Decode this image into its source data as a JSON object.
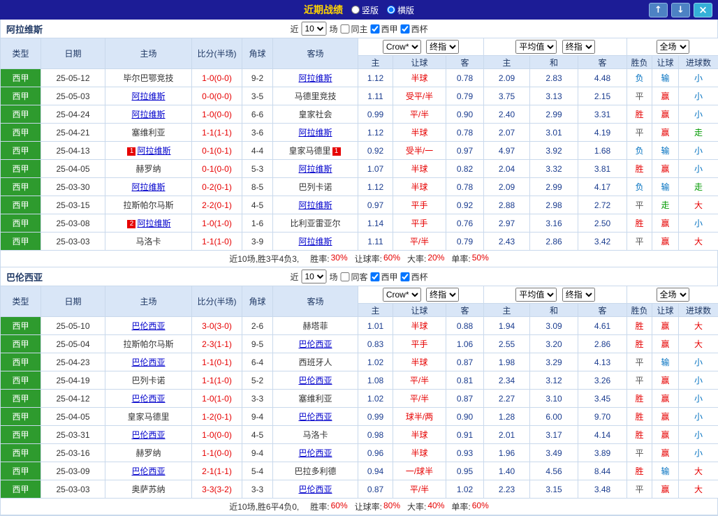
{
  "topbar": {
    "title": "近期战绩",
    "radios": [
      {
        "label": "竖版",
        "checked": false
      },
      {
        "label": "横版",
        "checked": true
      }
    ],
    "up_button": "↑",
    "down_button": "↓",
    "close_button": "×"
  },
  "labels": {
    "recent": "近",
    "matches": "场"
  },
  "filters": {
    "source": "Crow*",
    "source_stage": "终指",
    "average": "平均值",
    "average_stage": "终指",
    "scope": "全场"
  },
  "table_headers": {
    "type": "类型",
    "date": "日期",
    "home": "主场",
    "score": "比分(半场)",
    "corner": "角球",
    "away": "客场",
    "sub": [
      "主",
      "让球",
      "客",
      "主",
      "和",
      "客",
      "胜负",
      "让球",
      "进球数"
    ]
  },
  "colors": {
    "topbar_bg": "#1c1c96",
    "title_gold": "#ffd400",
    "league_green": "#2e9b2e",
    "header_blue": "#d9e6f7",
    "header_text": "#1f3864",
    "positive_red": "#e60000",
    "negative_blue": "#0070c0",
    "push_green": "#009900",
    "team_link_blue": "#0000cc",
    "odds_navy": "#1a3c8f",
    "button_blue": "#4d82c4",
    "close_teal": "#35b0d8",
    "border": "#c9d9ec"
  },
  "sections": [
    {
      "team": "阿拉维斯",
      "count": "10",
      "checkboxes": [
        {
          "label": "同主",
          "checked": false
        },
        {
          "label": "西甲",
          "checked": true
        },
        {
          "label": "西杯",
          "checked": true
        }
      ],
      "rows": [
        {
          "league": "西甲",
          "date": "25-05-12",
          "home": "毕尔巴鄂竞技",
          "home_badge": "",
          "score": "1-0(0-0)",
          "corner": "9-2",
          "away": "阿拉维斯",
          "away_badge": "",
          "ah_home": "1.12",
          "ah_line": "半球",
          "ah_away": "0.78",
          "eu_home": "2.09",
          "eu_draw": "2.83",
          "eu_away": "4.48",
          "result": "负",
          "ah_result": "输",
          "ou_result": "小"
        },
        {
          "league": "西甲",
          "date": "25-05-03",
          "home": "阿拉维斯",
          "home_badge": "",
          "score": "0-0(0-0)",
          "corner": "3-5",
          "away": "马德里竞技",
          "away_badge": "",
          "ah_home": "1.11",
          "ah_line": "受平/半",
          "ah_away": "0.79",
          "eu_home": "3.75",
          "eu_draw": "3.13",
          "eu_away": "2.15",
          "result": "平",
          "ah_result": "赢",
          "ou_result": "小"
        },
        {
          "league": "西甲",
          "date": "25-04-24",
          "home": "阿拉维斯",
          "home_badge": "",
          "score": "1-0(0-0)",
          "corner": "6-6",
          "away": "皇家社会",
          "away_badge": "",
          "ah_home": "0.99",
          "ah_line": "平/半",
          "ah_away": "0.90",
          "eu_home": "2.40",
          "eu_draw": "2.99",
          "eu_away": "3.31",
          "result": "胜",
          "ah_result": "赢",
          "ou_result": "小"
        },
        {
          "league": "西甲",
          "date": "25-04-21",
          "home": "塞维利亚",
          "home_badge": "",
          "score": "1-1(1-1)",
          "corner": "3-6",
          "away": "阿拉维斯",
          "away_badge": "",
          "ah_home": "1.12",
          "ah_line": "半球",
          "ah_away": "0.78",
          "eu_home": "2.07",
          "eu_draw": "3.01",
          "eu_away": "4.19",
          "result": "平",
          "ah_result": "赢",
          "ou_result": "走"
        },
        {
          "league": "西甲",
          "date": "25-04-13",
          "home": "阿拉维斯",
          "home_badge": "1",
          "score": "0-1(0-1)",
          "corner": "4-4",
          "away": "皇家马德里",
          "away_badge": "1",
          "ah_home": "0.92",
          "ah_line": "受半/一",
          "ah_away": "0.97",
          "eu_home": "4.97",
          "eu_draw": "3.92",
          "eu_away": "1.68",
          "result": "负",
          "ah_result": "输",
          "ou_result": "小"
        },
        {
          "league": "西甲",
          "date": "25-04-05",
          "home": "赫罗纳",
          "home_badge": "",
          "score": "0-1(0-0)",
          "corner": "5-3",
          "away": "阿拉维斯",
          "away_badge": "",
          "ah_home": "1.07",
          "ah_line": "半球",
          "ah_away": "0.82",
          "eu_home": "2.04",
          "eu_draw": "3.32",
          "eu_away": "3.81",
          "result": "胜",
          "ah_result": "赢",
          "ou_result": "小"
        },
        {
          "league": "西甲",
          "date": "25-03-30",
          "home": "阿拉维斯",
          "home_badge": "",
          "score": "0-2(0-1)",
          "corner": "8-5",
          "away": "巴列卡诺",
          "away_badge": "",
          "ah_home": "1.12",
          "ah_line": "半球",
          "ah_away": "0.78",
          "eu_home": "2.09",
          "eu_draw": "2.99",
          "eu_away": "4.17",
          "result": "负",
          "ah_result": "输",
          "ou_result": "走"
        },
        {
          "league": "西甲",
          "date": "25-03-15",
          "home": "拉斯帕尔马斯",
          "home_badge": "",
          "score": "2-2(0-1)",
          "corner": "4-5",
          "away": "阿拉维斯",
          "away_badge": "",
          "ah_home": "0.97",
          "ah_line": "平手",
          "ah_away": "0.92",
          "eu_home": "2.88",
          "eu_draw": "2.98",
          "eu_away": "2.72",
          "result": "平",
          "ah_result": "走",
          "ou_result": "大"
        },
        {
          "league": "西甲",
          "date": "25-03-08",
          "home": "阿拉维斯",
          "home_badge": "2",
          "score": "1-0(1-0)",
          "corner": "1-6",
          "away": "比利亚雷亚尔",
          "away_badge": "",
          "ah_home": "1.14",
          "ah_line": "平手",
          "ah_away": "0.76",
          "eu_home": "2.97",
          "eu_draw": "3.16",
          "eu_away": "2.50",
          "result": "胜",
          "ah_result": "赢",
          "ou_result": "小"
        },
        {
          "league": "西甲",
          "date": "25-03-03",
          "home": "马洛卡",
          "home_badge": "",
          "score": "1-1(1-0)",
          "corner": "3-9",
          "away": "阿拉维斯",
          "away_badge": "",
          "ah_home": "1.11",
          "ah_line": "平/半",
          "ah_away": "0.79",
          "eu_home": "2.43",
          "eu_draw": "2.86",
          "eu_away": "3.42",
          "result": "平",
          "ah_result": "赢",
          "ou_result": "大"
        }
      ],
      "summary": {
        "record": "近10场,胜3平4负3,",
        "stats": [
          {
            "label": "胜率:",
            "value": "30%"
          },
          {
            "label": "让球率:",
            "value": "60%"
          },
          {
            "label": "大率:",
            "value": "20%"
          },
          {
            "label": "单率:",
            "value": "50%"
          }
        ]
      }
    },
    {
      "team": "巴伦西亚",
      "count": "10",
      "checkboxes": [
        {
          "label": "同客",
          "checked": false
        },
        {
          "label": "西甲",
          "checked": true
        },
        {
          "label": "西杯",
          "checked": true
        }
      ],
      "rows": [
        {
          "league": "西甲",
          "date": "25-05-10",
          "home": "巴伦西亚",
          "home_badge": "",
          "score": "3-0(3-0)",
          "corner": "2-6",
          "away": "赫塔菲",
          "away_badge": "",
          "ah_home": "1.01",
          "ah_line": "半球",
          "ah_away": "0.88",
          "eu_home": "1.94",
          "eu_draw": "3.09",
          "eu_away": "4.61",
          "result": "胜",
          "ah_result": "赢",
          "ou_result": "大"
        },
        {
          "league": "西甲",
          "date": "25-05-04",
          "home": "拉斯帕尔马斯",
          "home_badge": "",
          "score": "2-3(1-1)",
          "corner": "9-5",
          "away": "巴伦西亚",
          "away_badge": "",
          "ah_home": "0.83",
          "ah_line": "平手",
          "ah_away": "1.06",
          "eu_home": "2.55",
          "eu_draw": "3.20",
          "eu_away": "2.86",
          "result": "胜",
          "ah_result": "赢",
          "ou_result": "大"
        },
        {
          "league": "西甲",
          "date": "25-04-23",
          "home": "巴伦西亚",
          "home_badge": "",
          "score": "1-1(0-1)",
          "corner": "6-4",
          "away": "西班牙人",
          "away_badge": "",
          "ah_home": "1.02",
          "ah_line": "半球",
          "ah_away": "0.87",
          "eu_home": "1.98",
          "eu_draw": "3.29",
          "eu_away": "4.13",
          "result": "平",
          "ah_result": "输",
          "ou_result": "小"
        },
        {
          "league": "西甲",
          "date": "25-04-19",
          "home": "巴列卡诺",
          "home_badge": "",
          "score": "1-1(1-0)",
          "corner": "5-2",
          "away": "巴伦西亚",
          "away_badge": "",
          "ah_home": "1.08",
          "ah_line": "平/半",
          "ah_away": "0.81",
          "eu_home": "2.34",
          "eu_draw": "3.12",
          "eu_away": "3.26",
          "result": "平",
          "ah_result": "赢",
          "ou_result": "小"
        },
        {
          "league": "西甲",
          "date": "25-04-12",
          "home": "巴伦西亚",
          "home_badge": "",
          "score": "1-0(1-0)",
          "corner": "3-3",
          "away": "塞维利亚",
          "away_badge": "",
          "ah_home": "1.02",
          "ah_line": "平/半",
          "ah_away": "0.87",
          "eu_home": "2.27",
          "eu_draw": "3.10",
          "eu_away": "3.45",
          "result": "胜",
          "ah_result": "赢",
          "ou_result": "小"
        },
        {
          "league": "西甲",
          "date": "25-04-05",
          "home": "皇家马德里",
          "home_badge": "",
          "score": "1-2(0-1)",
          "corner": "9-4",
          "away": "巴伦西亚",
          "away_badge": "",
          "ah_home": "0.99",
          "ah_line": "球半/两",
          "ah_away": "0.90",
          "eu_home": "1.28",
          "eu_draw": "6.00",
          "eu_away": "9.70",
          "result": "胜",
          "ah_result": "赢",
          "ou_result": "小"
        },
        {
          "league": "西甲",
          "date": "25-03-31",
          "home": "巴伦西亚",
          "home_badge": "",
          "score": "1-0(0-0)",
          "corner": "4-5",
          "away": "马洛卡",
          "away_badge": "",
          "ah_home": "0.98",
          "ah_line": "半球",
          "ah_away": "0.91",
          "eu_home": "2.01",
          "eu_draw": "3.17",
          "eu_away": "4.14",
          "result": "胜",
          "ah_result": "赢",
          "ou_result": "小"
        },
        {
          "league": "西甲",
          "date": "25-03-16",
          "home": "赫罗纳",
          "home_badge": "",
          "score": "1-1(0-0)",
          "corner": "9-4",
          "away": "巴伦西亚",
          "away_badge": "",
          "ah_home": "0.96",
          "ah_line": "半球",
          "ah_away": "0.93",
          "eu_home": "1.96",
          "eu_draw": "3.49",
          "eu_away": "3.89",
          "result": "平",
          "ah_result": "赢",
          "ou_result": "小"
        },
        {
          "league": "西甲",
          "date": "25-03-09",
          "home": "巴伦西亚",
          "home_badge": "",
          "score": "2-1(1-1)",
          "corner": "5-4",
          "away": "巴拉多利德",
          "away_badge": "",
          "ah_home": "0.94",
          "ah_line": "一/球半",
          "ah_away": "0.95",
          "eu_home": "1.40",
          "eu_draw": "4.56",
          "eu_away": "8.44",
          "result": "胜",
          "ah_result": "输",
          "ou_result": "大"
        },
        {
          "league": "西甲",
          "date": "25-03-03",
          "home": "奥萨苏纳",
          "home_badge": "",
          "score": "3-3(3-2)",
          "corner": "3-3",
          "away": "巴伦西亚",
          "away_badge": "",
          "ah_home": "0.87",
          "ah_line": "平/半",
          "ah_away": "1.02",
          "eu_home": "2.23",
          "eu_draw": "3.15",
          "eu_away": "3.48",
          "result": "平",
          "ah_result": "赢",
          "ou_result": "大"
        }
      ],
      "summary": {
        "record": "近10场,胜6平4负0,",
        "stats": [
          {
            "label": "胜率:",
            "value": "60%"
          },
          {
            "label": "让球率:",
            "value": "80%"
          },
          {
            "label": "大率:",
            "value": "40%"
          },
          {
            "label": "单率:",
            "value": "60%"
          }
        ]
      }
    }
  ]
}
